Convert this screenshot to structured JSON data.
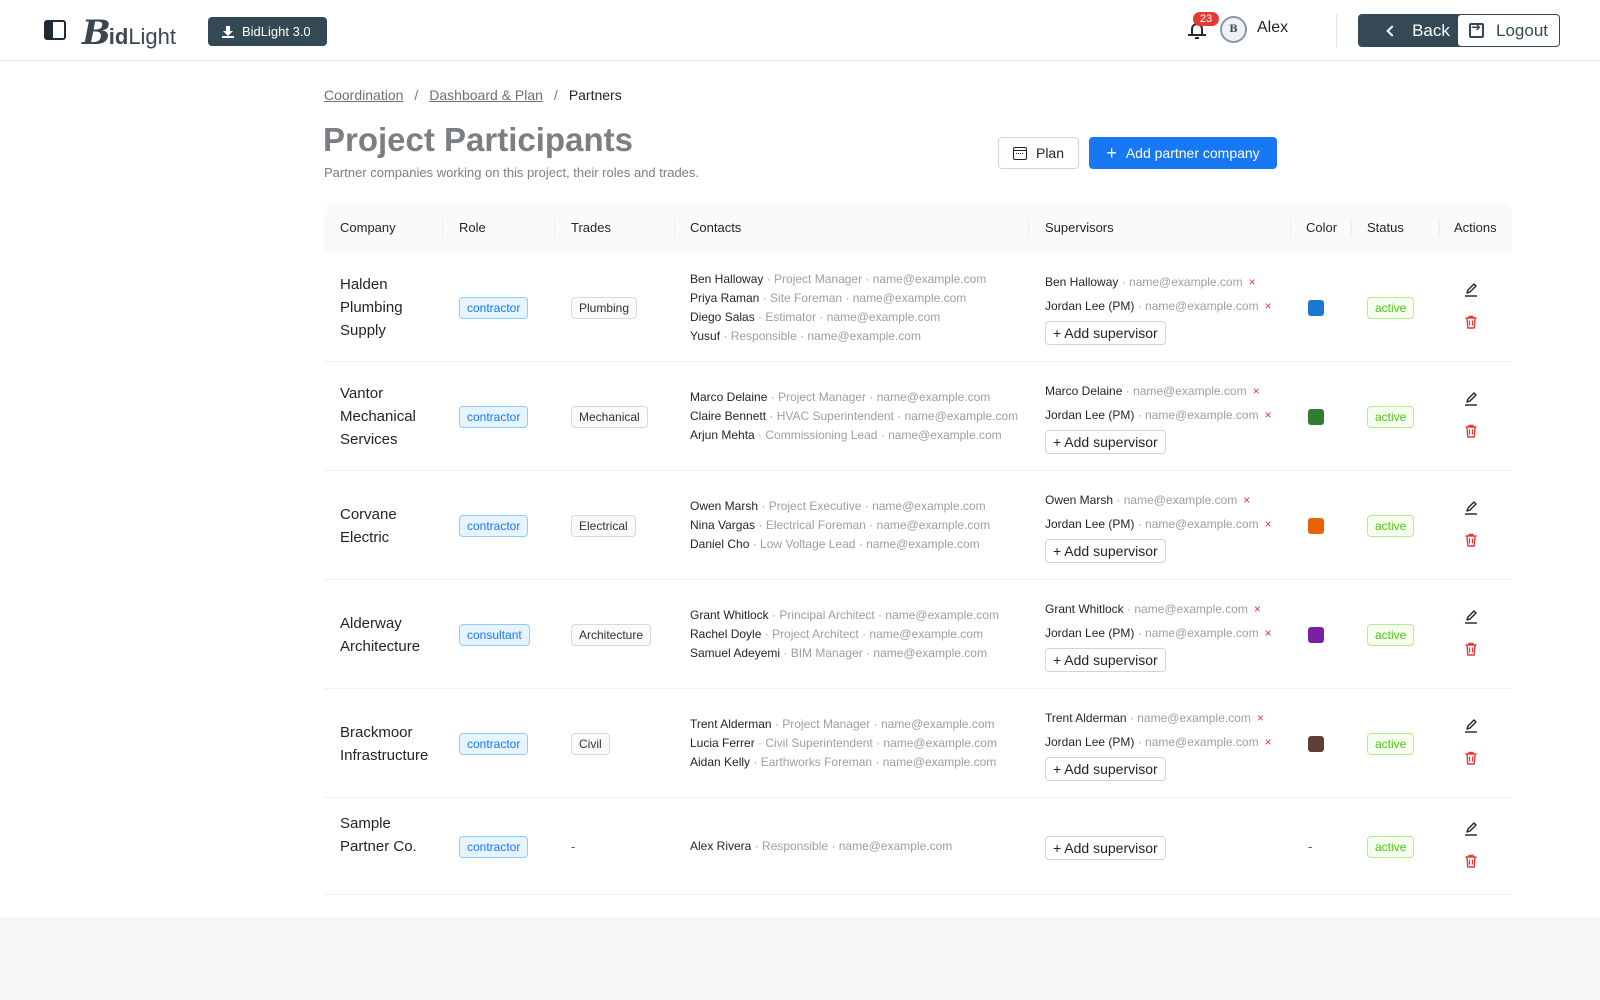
{
  "header": {
    "logo_initial": "B",
    "logo_bold": "id",
    "logo_light": "Light",
    "version_label": "BidLight 3.0",
    "notification_count": "23",
    "avatar_initials": "B",
    "username": "Alex",
    "back_label": "Back",
    "logout_label": "Logout"
  },
  "breadcrumb": [
    {
      "label": "Coordination"
    },
    {
      "label": "Dashboard & Plan"
    },
    {
      "label": "Partners"
    }
  ],
  "breadcrumb_separator": "/",
  "page": {
    "title": "Project Participants",
    "subtitle": "Partner companies working on this project, their roles and trades.",
    "plan_label": "Plan",
    "add_partner_label": "Add partner company"
  },
  "table": {
    "columns": [
      "Company",
      "Role",
      "Trades",
      "Contacts",
      "Supervisors",
      "Color",
      "Status",
      "Actions"
    ],
    "add_supervisor_label": "+ Add supervisor",
    "remove_symbol": "×",
    "rows": [
      {
        "company": "Halden Plumbing Supply",
        "role": "contractor",
        "trade": "Plumbing",
        "contacts": [
          {
            "name": "Ben Halloway",
            "meta": " · Project Manager · name@example.com"
          },
          {
            "name": "Priya Raman",
            "meta": " · Site Foreman · name@example.com"
          },
          {
            "name": "Diego Salas",
            "meta": " · Estimator · name@example.com"
          },
          {
            "name": "Yusuf",
            "meta": " · Responsible · name@example.com"
          }
        ],
        "supervisors": [
          {
            "name": "Ben Halloway",
            "meta": " · name@example.com"
          },
          {
            "name": "Jordan Lee (PM)",
            "meta": " · name@example.com"
          }
        ],
        "color": "#1e78d2",
        "status": "active"
      },
      {
        "company": "Vantor Mechanical Services",
        "role": "contractor",
        "trade": "Mechanical",
        "contacts": [
          {
            "name": "Marco Delaine",
            "meta": " · Project Manager · name@example.com"
          },
          {
            "name": "Claire Bennett",
            "meta": " · HVAC Superintendent · name@example.com"
          },
          {
            "name": "Arjun Mehta",
            "meta": " · Commissioning Lead · name@example.com"
          }
        ],
        "supervisors": [
          {
            "name": "Marco Delaine",
            "meta": " · name@example.com"
          },
          {
            "name": "Jordan Lee (PM)",
            "meta": " · name@example.com"
          }
        ],
        "color": "#2e7d32",
        "status": "active"
      },
      {
        "company": "Corvane Electric",
        "role": "contractor",
        "trade": "Electrical",
        "contacts": [
          {
            "name": "Owen Marsh",
            "meta": " · Project Executive · name@example.com"
          },
          {
            "name": "Nina Vargas",
            "meta": " · Electrical Foreman · name@example.com"
          },
          {
            "name": "Daniel Cho",
            "meta": " · Low Voltage Lead · name@example.com"
          }
        ],
        "supervisors": [
          {
            "name": "Owen Marsh",
            "meta": " · name@example.com"
          },
          {
            "name": "Jordan Lee (PM)",
            "meta": " · name@example.com"
          }
        ],
        "color": "#e8620a",
        "status": "active"
      },
      {
        "company": "Alderway Architecture",
        "role": "consultant",
        "trade": "Architecture",
        "contacts": [
          {
            "name": "Grant Whitlock",
            "meta": " · Principal Architect · name@example.com"
          },
          {
            "name": "Rachel Doyle",
            "meta": " · Project Architect · name@example.com"
          },
          {
            "name": "Samuel Adeyemi",
            "meta": " · BIM Manager · name@example.com"
          }
        ],
        "supervisors": [
          {
            "name": "Grant Whitlock",
            "meta": " · name@example.com"
          },
          {
            "name": "Jordan Lee (PM)",
            "meta": " · name@example.com"
          }
        ],
        "color": "#7b1fa2",
        "status": "active"
      },
      {
        "company": "Brackmoor Infrastructure",
        "role": "contractor",
        "trade": "Civil",
        "contacts": [
          {
            "name": "Trent Alderman",
            "meta": " · Project Manager · name@example.com"
          },
          {
            "name": "Lucia Ferrer",
            "meta": " · Civil Superintendent · name@example.com"
          },
          {
            "name": "Aidan Kelly",
            "meta": " · Earthworks Foreman · name@example.com"
          }
        ],
        "supervisors": [
          {
            "name": "Trent Alderman",
            "meta": " · name@example.com"
          },
          {
            "name": "Jordan Lee (PM)",
            "meta": " · name@example.com"
          }
        ],
        "color": "#5d4037",
        "status": "active"
      },
      {
        "company": "Sample Partner Co.",
        "role": "contractor",
        "trade": "-",
        "contacts": [
          {
            "name": "Alex Rivera",
            "meta": " · Responsible · name@example.com"
          }
        ],
        "supervisors": [],
        "color": "-",
        "status": "active"
      }
    ]
  }
}
